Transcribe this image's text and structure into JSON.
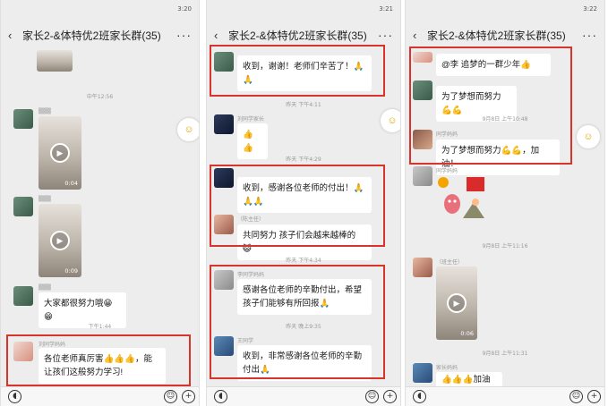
{
  "colors": {
    "highlight": "#d9342b",
    "bg": "#ededed",
    "bubble": "#ffffff"
  },
  "p1": {
    "time": "3:20",
    "title": "家长2-&体特优2班家长群(35)",
    "back_icon": "‹",
    "more_icon": "···",
    "ts1": "中午12:56",
    "vid1_dur": "0:04",
    "vid2_dur": "0:09",
    "msg1": "大家都很努力哦😁😁",
    "ts2": "下午1:44",
    "nick1": "刘同学妈妈",
    "msg2": "各位老师真厉害👍👍👍，能让孩们这般努力学习!"
  },
  "p2": {
    "time": "3:21",
    "title": "家长2-&体特优2班家长群(35)",
    "back_icon": "‹",
    "more_icon": "···",
    "msg1": "收到，谢谢！老师们辛苦了！🙏🙏",
    "ts1": "昨天 下午4:11",
    "nick1": "刘同学家长",
    "msg2": "👍👍",
    "ts2": "昨天 下午4:29",
    "msg3": "收到，感谢各位老师的付出！🙏🙏🙏",
    "nick2": "（陈主任）",
    "msg4": "共同努力 孩子们会越来越棒的 😺",
    "ts3": "昨天 下午4:34",
    "nick3": "李同学妈妈",
    "msg5": "感谢各位老师的辛勤付出，希望孩子们能够有所回报🙏",
    "ts4": "昨天 晚上9:35",
    "nick4": "王同学",
    "msg6": "收到，非常感谢各位老师的辛勤付出🙏"
  },
  "p3": {
    "time": "3:22",
    "title": "家长2-&体特优2班家长群(35)",
    "back_icon": "‹",
    "more_icon": "···",
    "msg1": "@李    追梦的一群少年👍",
    "msg2": "为了梦想而努力💪💪",
    "ts1": "9月8日 上午10:48",
    "nick1": "同学妈妈",
    "msg3": "为了梦想而努力💪💪，加油！",
    "nick2": "同学妈妈",
    "ts2": "9月8日 上午11:16",
    "nick3": "（班主任）",
    "vid_dur": "0:06",
    "ts3": "9月8日 上午11:31",
    "nick4": "家长妈妈",
    "msg4": "👍👍👍加油🙏"
  }
}
